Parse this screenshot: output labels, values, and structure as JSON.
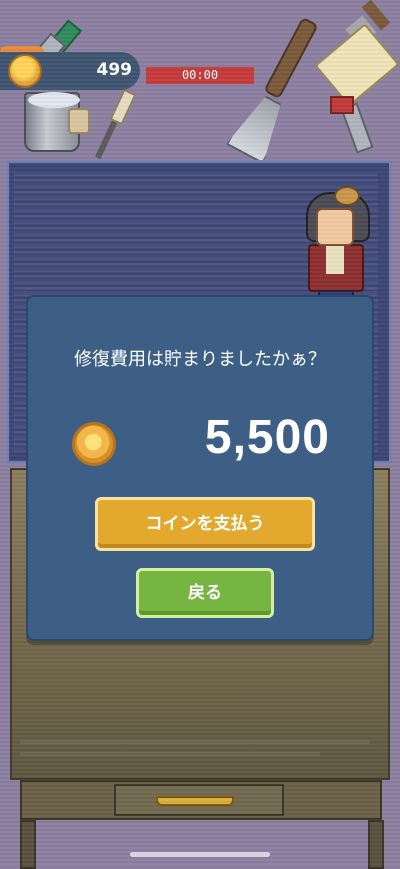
{
  "hud": {
    "coins": "499",
    "timer": "00:00",
    "icon": "coin-icon"
  },
  "dialog": {
    "question": "修復費用は貯まりましたかぁ？",
    "cost": "5,500",
    "cost_icon": "coin-icon",
    "pay_label": "コインを支払う",
    "back_label": "戻る"
  },
  "colors": {
    "background": "#8c7fa0",
    "dialog": "#3d5f86",
    "pay_button": "#e2a92e",
    "back_button": "#76b541",
    "timer_bar": "#c63a3a"
  }
}
